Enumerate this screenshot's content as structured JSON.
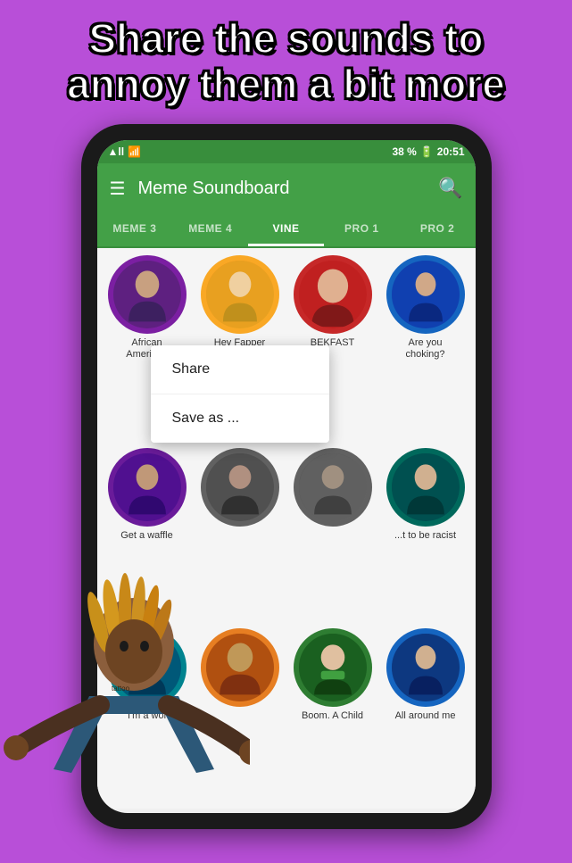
{
  "headline": {
    "line1": "Share the sounds to",
    "line2": "annoy them a bit more"
  },
  "status_bar": {
    "signal": "▲.▲▲",
    "wifi": "WiFi",
    "battery_percent": "38 %",
    "battery_icon": "🔋",
    "time": "20:51"
  },
  "app_bar": {
    "title": "Meme Soundboard",
    "menu_icon": "☰",
    "search_icon": "🔍"
  },
  "tabs": [
    {
      "label": "MEME 3",
      "active": false
    },
    {
      "label": "MEME 4",
      "active": false
    },
    {
      "label": "VINE",
      "active": true
    },
    {
      "label": "PRO 1",
      "active": false
    },
    {
      "label": "PRO 2",
      "active": false
    }
  ],
  "sounds": [
    {
      "label": "African\nAmerican",
      "color": "purple"
    },
    {
      "label": "Hey Fapper\nFapper",
      "color": "yellow"
    },
    {
      "label": "BEKFAST",
      "color": "red"
    },
    {
      "label": "Are you\nchoking?",
      "color": "blue"
    },
    {
      "label": "Get a waffle",
      "color": "purple2"
    },
    {
      "label": "",
      "color": "gray"
    },
    {
      "label": "",
      "color": "gray"
    },
    {
      "label": "...t to be racist",
      "color": "teal"
    },
    {
      "label": "I'm a wol",
      "color": "cyan"
    },
    {
      "label": "",
      "color": "orange"
    },
    {
      "label": "Boom. A Child",
      "color": "green"
    },
    {
      "label": "All around me",
      "color": "blue2"
    }
  ],
  "context_menu": {
    "items": [
      "Share",
      "Save as ..."
    ]
  },
  "colors": {
    "background": "#b84fd8",
    "app_bar": "#43a047",
    "status_bar": "#388e3c",
    "active_tab_indicator": "#ffffff"
  }
}
